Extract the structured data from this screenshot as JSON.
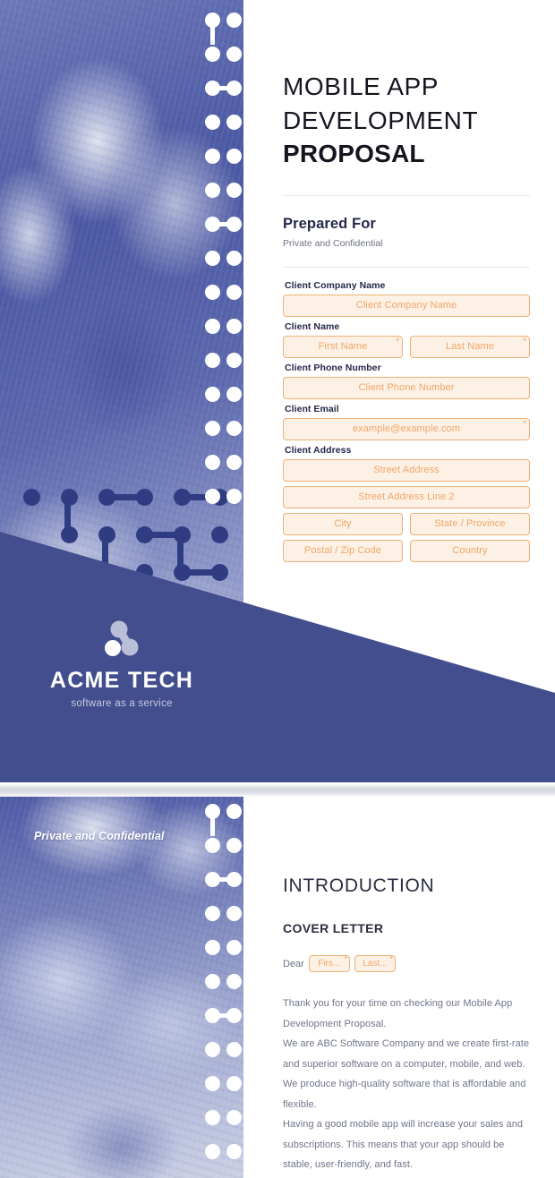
{
  "document": {
    "type": "form-document-preview",
    "accent_blue": "#434e8e",
    "field_border": "#f0b076",
    "field_fill": "#fdf0e5",
    "field_text": "#f0a868",
    "heading_navy": "#2b2d42"
  },
  "page1": {
    "title": {
      "line1": "MOBILE APP",
      "line2": "DEVELOPMENT",
      "line3": "PROPOSAL"
    },
    "prepared": {
      "heading": "Prepared For",
      "subtitle": "Private and Confidential"
    },
    "form": {
      "company": {
        "label": "Client Company Name",
        "placeholder": "Client Company Name"
      },
      "name": {
        "label": "Client Name",
        "first_placeholder": "First Name",
        "last_placeholder": "Last Name"
      },
      "phone": {
        "label": "Client Phone Number",
        "placeholder": "Client Phone Number"
      },
      "email": {
        "label": "Client Email",
        "placeholder": "example@example.com"
      },
      "address": {
        "label": "Client Address",
        "street_placeholder": "Street Address",
        "street2_placeholder": "Street Address Line 2",
        "city_placeholder": "City",
        "state_placeholder": "State / Province",
        "postal_placeholder": "Postal / Zip Code",
        "country_placeholder": "Country"
      }
    },
    "logo": {
      "name": "ACME TECH",
      "tagline": "software as a service",
      "mark": "molecule-node-icon"
    }
  },
  "page2": {
    "confidential_banner": "Private and Confidential",
    "section_title": "INTRODUCTION",
    "section_subtitle": "COVER LETTER",
    "salutation": {
      "label": "Dear",
      "first_placeholder": "Firs...",
      "last_placeholder": "Last..."
    },
    "body": [
      "Thank you for your time on checking our Mobile App Development Proposal.",
      "We are ABC Software Company and we create first-rate and superior software on a computer, mobile, and web. We produce high-quality software that is affordable and flexible.",
      "Having a good mobile app will increase your sales and subscriptions. This means that your app should be stable, user-friendly, and fast."
    ]
  }
}
